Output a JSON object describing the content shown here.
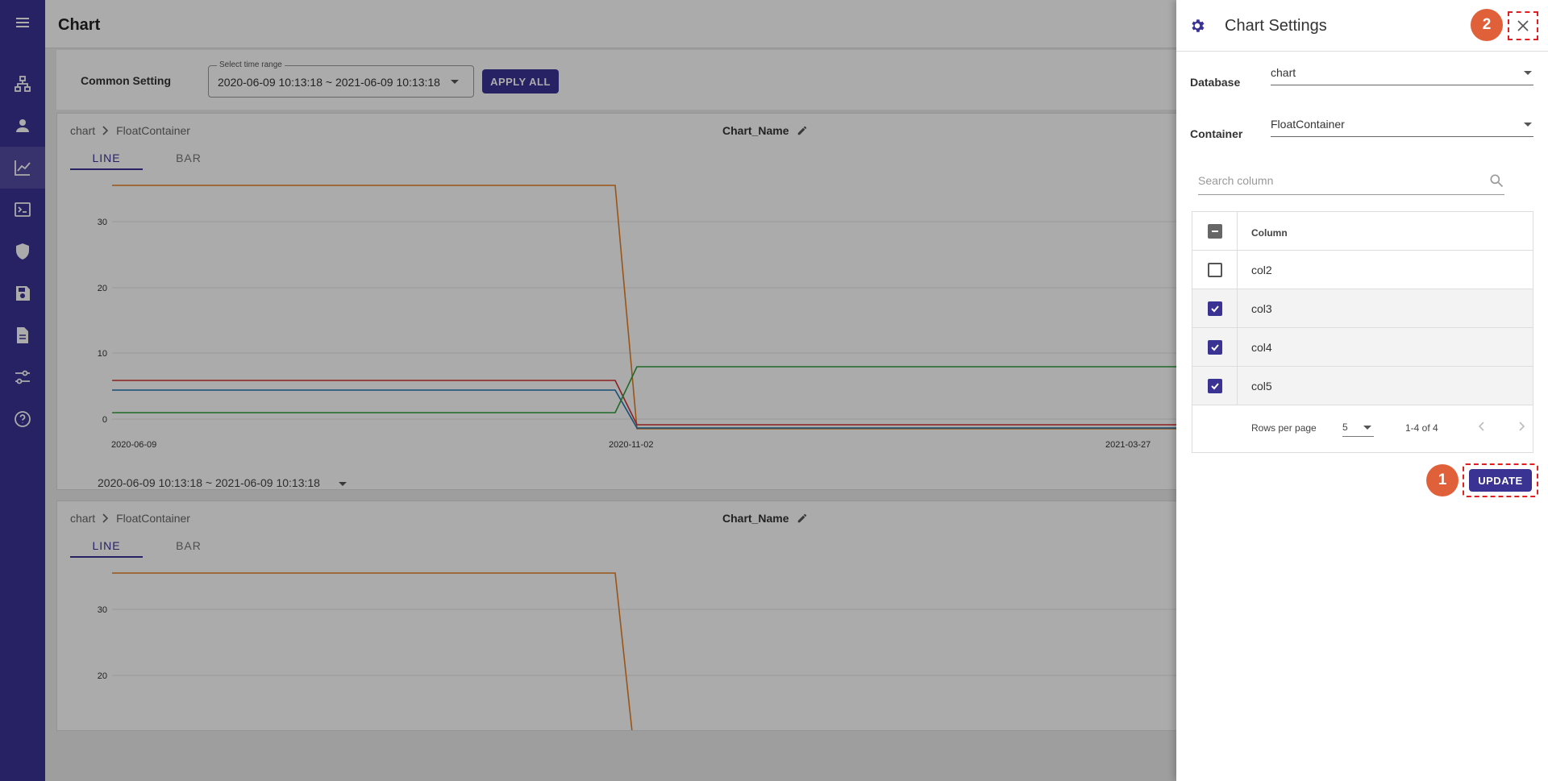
{
  "app": {
    "page_title": "Chart"
  },
  "sidebar": {
    "items": [
      {
        "icon": "menu-icon"
      },
      {
        "icon": "sitemap-icon"
      },
      {
        "icon": "person-icon"
      },
      {
        "icon": "chart-line-icon",
        "active": true
      },
      {
        "icon": "terminal-icon"
      },
      {
        "icon": "shield-icon"
      },
      {
        "icon": "save-icon"
      },
      {
        "icon": "document-icon"
      },
      {
        "icon": "settings-sliders-icon"
      },
      {
        "icon": "help-icon"
      }
    ]
  },
  "common_setting": {
    "label": "Common Setting",
    "range_legend": "Select time range",
    "range_value": "2020-06-09 10:13:18 ~ 2021-06-09 10:13:18",
    "apply_label": "APPLY ALL"
  },
  "cards": [
    {
      "crumb_db": "chart",
      "crumb_container": "FloatContainer",
      "chart_name": "Chart_Name",
      "tab_line": "LINE",
      "tab_bar": "BAR",
      "range_value": "2020-06-09 10:13:18 ~ 2021-06-09 10:13:18"
    },
    {
      "crumb_db": "chart",
      "crumb_container": "FloatContainer",
      "chart_name": "Chart_Name",
      "tab_line": "LINE",
      "tab_bar": "BAR"
    }
  ],
  "chart_data": [
    {
      "type": "line",
      "x_labels": [
        "2020-06-09",
        "2020-11-02",
        "2021-03-27"
      ],
      "y_ticks": [
        0,
        10,
        20,
        30
      ],
      "ylim": [
        -1,
        37
      ],
      "series": [
        {
          "color": "#e67e22",
          "points": [
            [
              "2020-06-09",
              36
            ],
            [
              "2020-10-29",
              36
            ],
            [
              "2020-11-02",
              -0.5
            ],
            [
              "2021-06-09",
              -0.5
            ]
          ]
        },
        {
          "color": "#d32f2f",
          "points": [
            [
              "2020-06-09",
              6
            ],
            [
              "2020-10-29",
              6
            ],
            [
              "2020-11-02",
              0
            ],
            [
              "2021-06-09",
              0
            ]
          ]
        },
        {
          "color": "#1f77b4",
          "points": [
            [
              "2020-06-09",
              4.5
            ],
            [
              "2020-10-29",
              4.5
            ],
            [
              "2020-11-02",
              -0.3
            ],
            [
              "2021-06-09",
              -0.3
            ]
          ]
        },
        {
          "color": "#2e9e3a",
          "points": [
            [
              "2020-06-09",
              1
            ],
            [
              "2020-10-29",
              1
            ],
            [
              "2020-11-02",
              8
            ],
            [
              "2021-06-09",
              8
            ]
          ]
        }
      ]
    },
    {
      "type": "line",
      "y_ticks": [
        20,
        30
      ],
      "ylim": [
        -1,
        37
      ],
      "series": [
        {
          "color": "#e67e22",
          "points": [
            [
              "2020-06-09",
              36
            ],
            [
              "2020-10-29",
              36
            ],
            [
              "2020-11-02",
              -0.5
            ]
          ]
        }
      ]
    }
  ],
  "drawer": {
    "title": "Chart Settings",
    "database_label": "Database",
    "database_value": "chart",
    "container_label": "Container",
    "container_value": "FloatContainer",
    "search_placeholder": "Search column",
    "column_header": "Column",
    "columns": [
      {
        "name": "col2",
        "checked": false
      },
      {
        "name": "col3",
        "checked": true
      },
      {
        "name": "col4",
        "checked": true
      },
      {
        "name": "col5",
        "checked": true
      }
    ],
    "rows_per_page_label": "Rows per page",
    "rows_per_page_value": "5",
    "page_info": "1-4 of 4",
    "update_label": "UPDATE",
    "badge_update": "1",
    "badge_close": "2"
  },
  "colors": {
    "brand": "#3b3394",
    "highlight": "#e02020",
    "badge": "#e0603a"
  }
}
